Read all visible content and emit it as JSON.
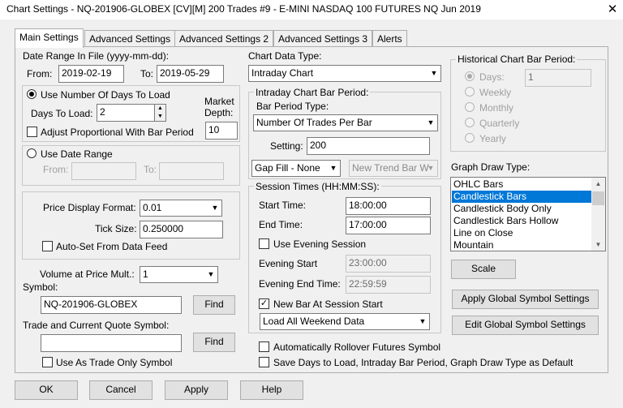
{
  "window": {
    "title": "Chart Settings - NQ-201906-GLOBEX [CV][M]  200 Trades  #9 - E-MINI NASDAQ 100 FUTURES NQ Jun 2019",
    "close_glyph": "✕"
  },
  "tabs": [
    "Main Settings",
    "Advanced Settings",
    "Advanced Settings 2",
    "Advanced Settings 3",
    "Alerts"
  ],
  "date_range": {
    "label": "Date Range In File (yyyy-mm-dd):",
    "from_label": "From:",
    "from_value": "2019-02-19",
    "to_label": "To:",
    "to_value": "2019-05-29"
  },
  "days_group": {
    "use_days_label": "Use Number Of Days To Load",
    "days_label": "Days To Load:",
    "days_value": "2",
    "market_depth_label1": "Market",
    "market_depth_label2": "Depth:",
    "market_depth_value": "10",
    "adjust_label": "Adjust Proportional With Bar Period"
  },
  "date_range_group": {
    "use_date_range_label": "Use Date Range",
    "from_label": "From:",
    "to_label": "To:"
  },
  "price_group": {
    "format_label": "Price Display Format:",
    "format_value": "0.01",
    "tick_label": "Tick Size:",
    "tick_value": "0.250000",
    "autoset_label": "Auto-Set From Data Feed"
  },
  "volume": {
    "label": "Volume at Price Mult.:",
    "value": "1"
  },
  "symbol": {
    "label": "Symbol:",
    "value": "NQ-201906-GLOBEX",
    "find": "Find"
  },
  "trade_symbol": {
    "label": "Trade and Current Quote Symbol:",
    "value": "",
    "find": "Find",
    "trade_only_label": "Use As Trade Only Symbol"
  },
  "chart_data": {
    "label": "Chart Data Type:",
    "value": "Intraday Chart"
  },
  "intraday": {
    "group_label": "Intraday Chart Bar Period:",
    "type_label": "Bar Period Type:",
    "type_value": "Number Of Trades Per Bar",
    "setting_label": "Setting:",
    "setting_value": "200",
    "gapfill_value": "Gap Fill - None",
    "newtrend_value": "New Trend Bar W"
  },
  "session": {
    "group_label": "Session Times (HH:MM:SS):",
    "start_label": "Start Time:",
    "start_value": "18:00:00",
    "end_label": "End Time:",
    "end_value": "17:00:00",
    "use_evening_label": "Use Evening Session",
    "evening_start_label": "Evening Start",
    "evening_start_value": "23:00:00",
    "evening_end_label": "Evening End Time:",
    "evening_end_value": "22:59:59",
    "new_bar_label": "New Bar At Session Start",
    "weekend_value": "Load All Weekend Data"
  },
  "auto_rollover_label": "Automatically Rollover Futures Symbol",
  "save_defaults_label": "Save Days to Load, Intraday Bar Period, Graph Draw Type as Default",
  "historical": {
    "label": "Historical Chart Bar Period:",
    "days_label": "Days:",
    "days_value": "1",
    "weekly": "Weekly",
    "monthly": "Monthly",
    "quarterly": "Quarterly",
    "yearly": "Yearly"
  },
  "graph_draw": {
    "label": "Graph Draw Type:",
    "items": [
      "OHLC Bars",
      "Candlestick Bars",
      "Candlestick Body Only",
      "Candlestick Bars Hollow",
      "Line on Close",
      "Mountain"
    ],
    "selected_index": 1
  },
  "buttons": {
    "scale": "Scale",
    "apply_global": "Apply Global Symbol Settings",
    "edit_global": "Edit Global Symbol Settings",
    "ok": "OK",
    "cancel": "Cancel",
    "apply": "Apply",
    "help": "Help"
  },
  "icons": {
    "dropdown": "chevron-down-icon",
    "check": "checkmark-icon",
    "spin": "spinner-arrows-icon"
  },
  "colors": {
    "selection": "#0078d7",
    "background": "#f0f0f0",
    "disabled_text": "#a0a0a0"
  }
}
